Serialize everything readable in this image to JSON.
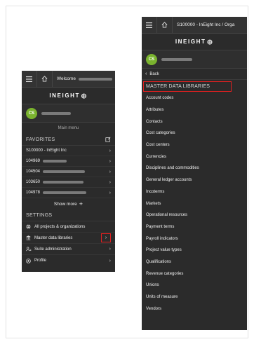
{
  "left_panel": {
    "topbar": {
      "menu_icon": "hamburger-icon",
      "home_icon": "home-icon",
      "welcome_text": "Welcome"
    },
    "logo": "INEIGHT",
    "user": {
      "initials": "CS"
    },
    "main_menu_label": "Main menu",
    "favorites": {
      "title": "FAVORITES",
      "items": [
        {
          "label": "S100000 - InEight Inc"
        },
        {
          "label": "104969"
        },
        {
          "label": "104504"
        },
        {
          "label": "103650"
        },
        {
          "label": "104978"
        }
      ],
      "show_more": "Show more"
    },
    "settings": {
      "title": "SETTINGS",
      "items": [
        {
          "label": "All projects & organizations",
          "icon": "globe-icon"
        },
        {
          "label": "Master data libraries",
          "icon": "library-icon"
        },
        {
          "label": "Suite administration",
          "icon": "users-icon"
        },
        {
          "label": "Profile",
          "icon": "profile-icon"
        }
      ]
    },
    "highlight_color": "#e02020"
  },
  "right_panel": {
    "topbar": {
      "menu_icon": "hamburger-icon",
      "home_icon": "home-icon",
      "breadcrumb": "S100000 - InEight Inc  /  Orga"
    },
    "logo": "INEIGHT",
    "user": {
      "initials": "CS"
    },
    "back_label": "Back",
    "section_title": "MASTER DATA LIBRARIES",
    "items": [
      "Account codes",
      "Attributes",
      "Contacts",
      "Cost categories",
      "Cost centers",
      "Currencies",
      "Disciplines and commodities",
      "General ledger accounts",
      "Incoterms",
      "Markets",
      "Operational resources",
      "Payment terms",
      "Payroll indicators",
      "Project value types",
      "Qualifications",
      "Revenue categories",
      "Unions",
      "Units of measure",
      "Vendors"
    ]
  }
}
